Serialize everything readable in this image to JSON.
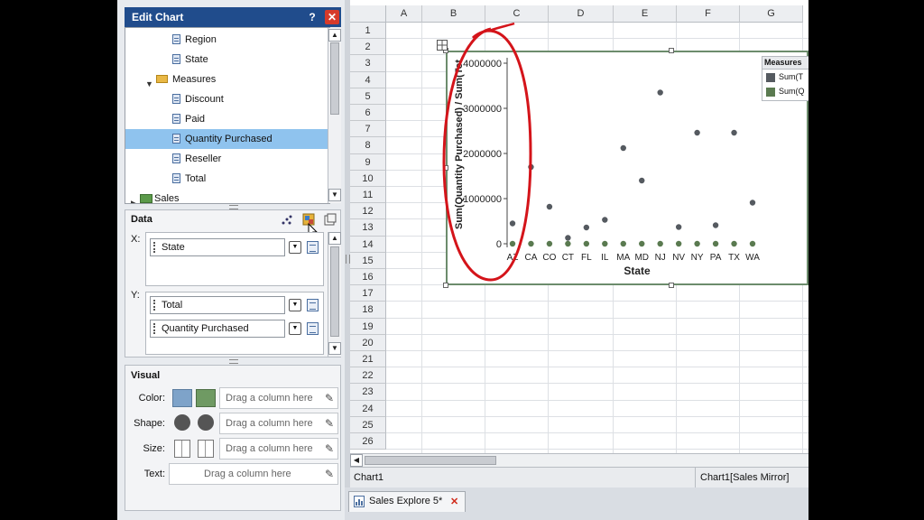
{
  "panel": {
    "title": "Edit Chart",
    "help_label": "?",
    "close_label": "✕"
  },
  "tree": {
    "items": [
      {
        "label": "Region",
        "kind": "field"
      },
      {
        "label": "State",
        "kind": "field"
      },
      {
        "label": "Measures",
        "kind": "folder"
      },
      {
        "label": "Discount",
        "kind": "field"
      },
      {
        "label": "Paid",
        "kind": "field"
      },
      {
        "label": "Quantity Purchased",
        "kind": "field",
        "selected": true
      },
      {
        "label": "Reseller",
        "kind": "field"
      },
      {
        "label": "Total",
        "kind": "field"
      },
      {
        "label": "Sales",
        "kind": "table"
      }
    ]
  },
  "data_section": {
    "title": "Data",
    "x_label": "X:",
    "y_label": "Y:",
    "x_fields": [
      "State"
    ],
    "y_fields": [
      "Total",
      "Quantity Purchased"
    ]
  },
  "visual_section": {
    "title": "Visual",
    "rows": [
      {
        "label": "Color:",
        "hint": "Drag a column here",
        "swatches": [
          "#7ea3c9",
          "#6f9a63"
        ]
      },
      {
        "label": "Shape:",
        "hint": "Drag a column here"
      },
      {
        "label": "Size:",
        "hint": "Drag a column here"
      },
      {
        "label": "Text:",
        "hint": "Drag a column here"
      }
    ]
  },
  "sheet": {
    "columns": [
      "A",
      "B",
      "C",
      "D",
      "E",
      "F",
      "G"
    ],
    "rows": [
      "1",
      "2",
      "3",
      "4",
      "5",
      "6",
      "7",
      "8",
      "9",
      "10",
      "11",
      "12",
      "13",
      "14",
      "15",
      "16",
      "17",
      "18",
      "19",
      "20",
      "21",
      "22",
      "23",
      "24",
      "25",
      "26"
    ]
  },
  "chart_data": {
    "type": "scatter",
    "xlabel": "State",
    "ylabel": "Sum(Quantity Purchased) / Sum(Tot",
    "categories": [
      "AZ",
      "CA",
      "CO",
      "CT",
      "FL",
      "IL",
      "MA",
      "MD",
      "NJ",
      "NV",
      "NY",
      "PA",
      "TX",
      "WA"
    ],
    "yticks": [
      "4000000",
      "3000000",
      "2000000",
      "1000000",
      "0"
    ],
    "ylim": [
      0,
      4000000
    ],
    "legend_title": "Measures",
    "legend_position": "right",
    "series": [
      {
        "name": "Sum(T",
        "color": "#555a60",
        "values": [
          450000,
          1700000,
          820000,
          130000,
          360000,
          530000,
          2120000,
          1400000,
          3350000,
          370000,
          2460000,
          410000,
          2460000,
          910000
        ]
      },
      {
        "name": "Sum(Q",
        "color": "#5a7a50",
        "values": [
          0,
          0,
          0,
          0,
          0,
          0,
          0,
          0,
          0,
          0,
          0,
          0,
          0,
          0
        ]
      }
    ]
  },
  "status": {
    "left": "Chart1",
    "right": "Chart1[Sales Mirror]"
  },
  "tab": {
    "label": "Sales Explore 5*",
    "close": "✕"
  }
}
